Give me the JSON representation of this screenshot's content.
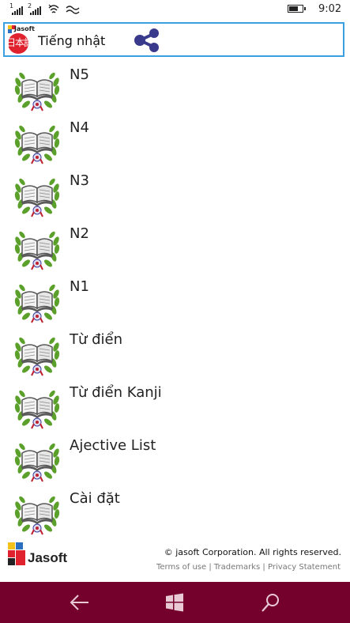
{
  "status_bar": {
    "sim1": "1",
    "sim2": "2",
    "battery_level": 0.7,
    "time": "9:02"
  },
  "header": {
    "logo_small_text": "Jasoft",
    "logo_kanji": "日本語",
    "title": "Tiếng nhật",
    "share_icon": "share-icon"
  },
  "menu": {
    "icon": "book-laurel-icon",
    "items": [
      {
        "label": "N5"
      },
      {
        "label": "N4"
      },
      {
        "label": "N3"
      },
      {
        "label": "N2"
      },
      {
        "label": "N1"
      },
      {
        "label": "Từ điển"
      },
      {
        "label": "Từ điển Kanji"
      },
      {
        "label": "Ajective List"
      },
      {
        "label": "Cài đặt"
      }
    ]
  },
  "footer": {
    "logo_text": "Jasoft",
    "copyright": "© jasoft Corporation. All rights reserved.",
    "terms": "Terms of use",
    "trademarks": "Trademarks",
    "privacy": "Privacy Statement",
    "separator": " | "
  },
  "nav_bar": {
    "color": "#74002c",
    "buttons": [
      "back-icon",
      "windows-icon",
      "search-icon"
    ]
  },
  "colors": {
    "accent_border": "#3aa0e0",
    "laurel": "#5aa02a",
    "kanji_circle": "#e0222e"
  }
}
